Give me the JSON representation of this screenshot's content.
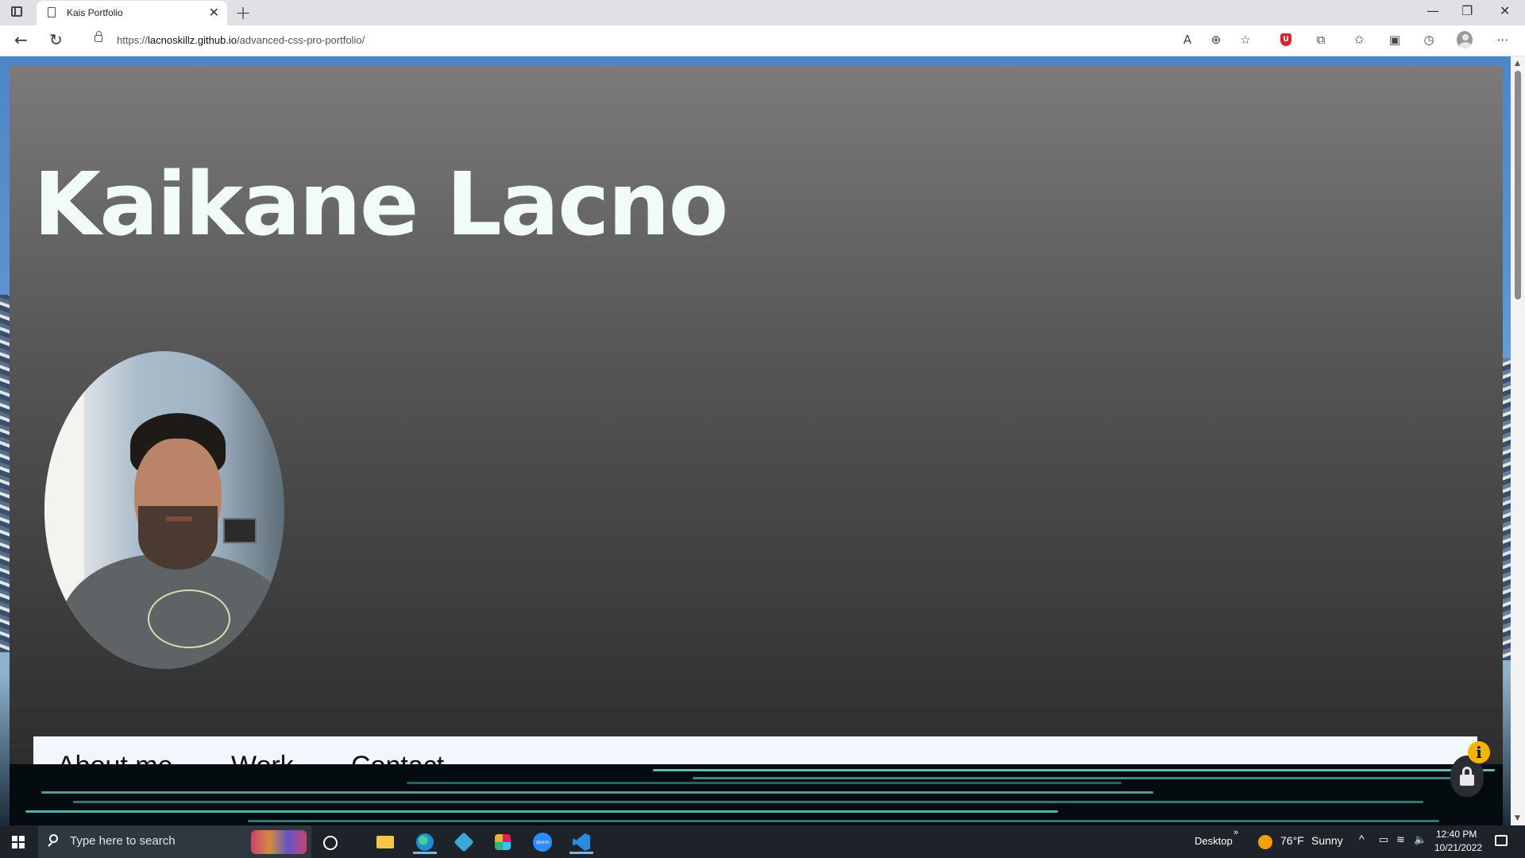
{
  "browser": {
    "tab_title": "Kais Portfolio",
    "tab_close": "✕",
    "new_tab": "+",
    "url_prefix": "https://",
    "url_domain": "lacnoskillz.github.io",
    "url_path": "/advanced-css-pro-portfolio/",
    "window_controls": {
      "minimize": "—",
      "restore": "❐",
      "close": "✕"
    }
  },
  "page": {
    "heading": "Kaikane Lacno",
    "nav": [
      "About me",
      "Work",
      "Contact"
    ],
    "info_badge": "i"
  },
  "taskbar": {
    "search_placeholder": "Type here to search",
    "desktop_label": "Desktop",
    "weather_temp": "76°F",
    "weather_desc": "Sunny",
    "time": "12:40 PM",
    "date": "10/21/2022"
  },
  "colors": {
    "heading": "#f1fbfa",
    "navbar_bg": "#f2f7fd",
    "panel_top": "#7c7a7b",
    "panel_bottom": "#2d2d2d"
  }
}
